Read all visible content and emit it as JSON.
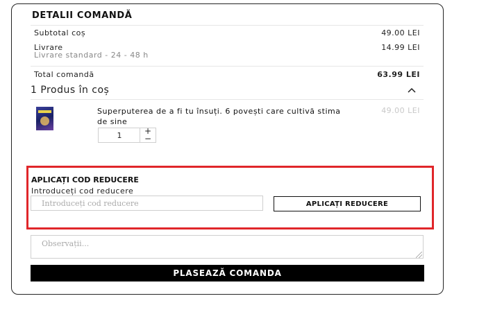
{
  "order_details": {
    "title": "DETALII COMANDĂ",
    "subtotal_label": "Subtotal coș",
    "subtotal_value": "49.00 LEI",
    "shipping_label": "Livrare",
    "shipping_method": "Livrare standard - 24 - 48 h",
    "shipping_value": "14.99 LEI",
    "total_label": "Total comandă",
    "total_value": "63.99 LEI"
  },
  "cart": {
    "toggle_label": "1 Produs în coș",
    "toggle_icon": "chevron-up-icon",
    "items": [
      {
        "name": "Superputerea de a fi tu însuți. 6 povești care cultivă stima de sine",
        "price": "49.00 LEI",
        "quantity": "1",
        "plus": "+",
        "minus": "−"
      }
    ]
  },
  "discount": {
    "title": "APLICAȚI COD REDUCERE",
    "label": "Introduceți cod reducere",
    "placeholder": "Introduceți cod reducere",
    "button": "APLICAȚI REDUCERE",
    "highlight_color": "#e0262a"
  },
  "notes": {
    "placeholder": "Observații..."
  },
  "place_order": {
    "label": "PLASEAZĂ COMANDA",
    "background": "#000000"
  }
}
